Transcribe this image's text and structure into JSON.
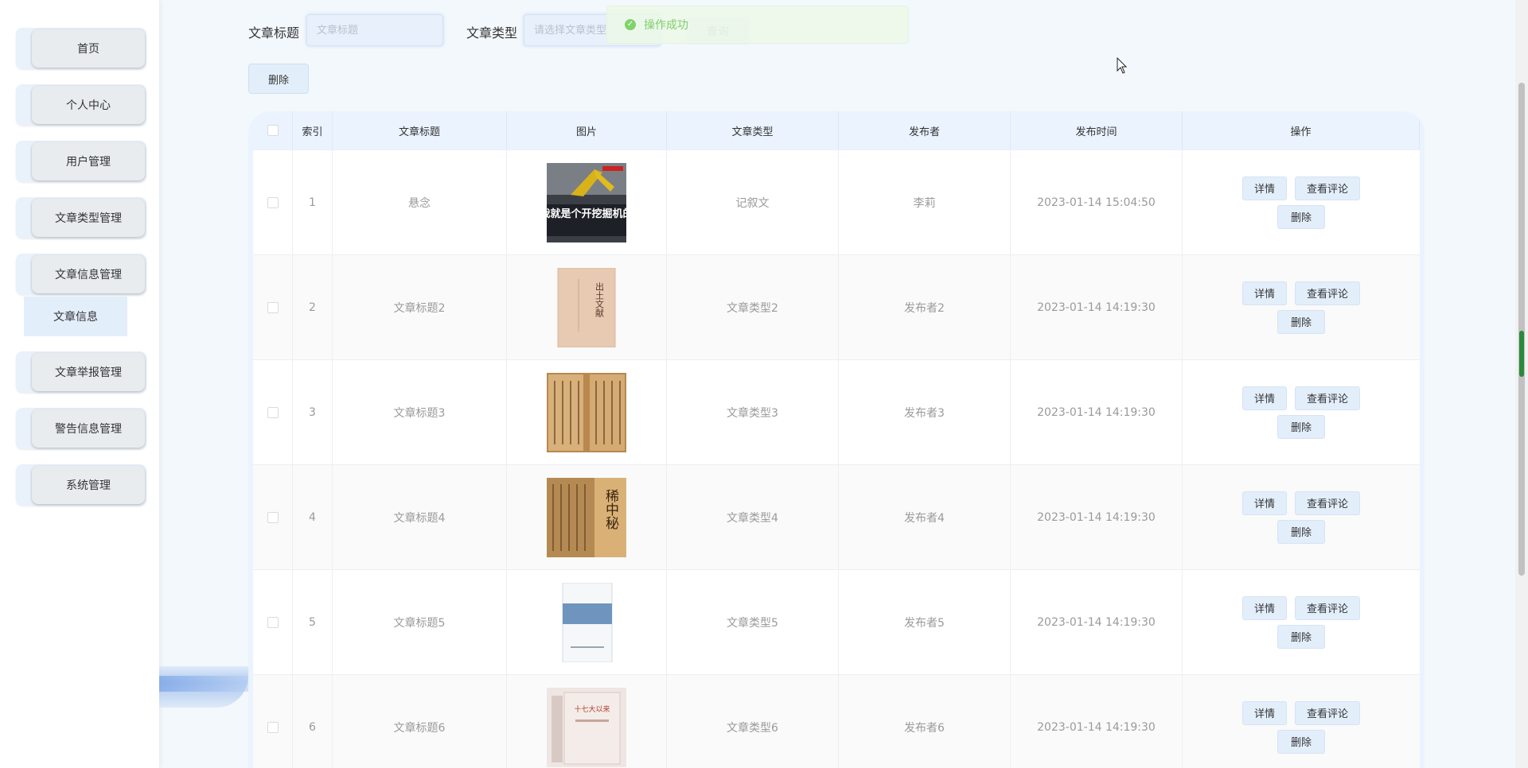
{
  "sidebar": {
    "items": [
      {
        "label": "首页"
      },
      {
        "label": "个人中心"
      },
      {
        "label": "用户管理"
      },
      {
        "label": "文章类型管理"
      },
      {
        "label": "文章信息管理"
      },
      {
        "label": "文章举报管理"
      },
      {
        "label": "警告信息管理"
      },
      {
        "label": "系统管理"
      }
    ],
    "submenu_label": "文章信息"
  },
  "search": {
    "title_label": "文章标题",
    "title_placeholder": "文章标题",
    "type_label": "文章类型",
    "type_placeholder": "请选择文章类型",
    "query_label": "查询"
  },
  "toolbar": {
    "delete_label": "删除"
  },
  "toast": {
    "message": "操作成功"
  },
  "table": {
    "headers": {
      "index": "索引",
      "title": "文章标题",
      "image": "图片",
      "type": "文章类型",
      "publisher": "发布者",
      "time": "发布时间",
      "ops": "操作"
    },
    "ops_labels": {
      "detail": "详情",
      "comments": "查看评论",
      "delete": "删除"
    },
    "rows": [
      {
        "index": "1",
        "title": "悬念",
        "type": "记叙文",
        "publisher": "李莉",
        "time": "2023-01-14 15:04:50",
        "cover": "excavator",
        "cover_text": "我就是个开挖掘机的"
      },
      {
        "index": "2",
        "title": "文章标题2",
        "type": "文章类型2",
        "publisher": "发布者2",
        "time": "2023-01-14 14:19:30",
        "cover": "book-beige",
        "cover_text": "出土文献"
      },
      {
        "index": "3",
        "title": "文章标题3",
        "type": "文章类型3",
        "publisher": "发布者3",
        "time": "2023-01-14 14:19:30",
        "cover": "ancient-script",
        "cover_text": ""
      },
      {
        "index": "4",
        "title": "文章标题4",
        "type": "文章类型4",
        "publisher": "发布者4",
        "time": "2023-01-14 14:19:30",
        "cover": "ancient-calligraphy",
        "cover_text": "稀中秘"
      },
      {
        "index": "5",
        "title": "文章标题5",
        "type": "文章类型5",
        "publisher": "发布者5",
        "time": "2023-01-14 14:19:30",
        "cover": "book-blue-band",
        "cover_text": ""
      },
      {
        "index": "6",
        "title": "文章标题6",
        "type": "文章类型6",
        "publisher": "发布者6",
        "time": "2023-01-14 14:19:30",
        "cover": "book-set",
        "cover_text": "十七大以来"
      }
    ]
  }
}
